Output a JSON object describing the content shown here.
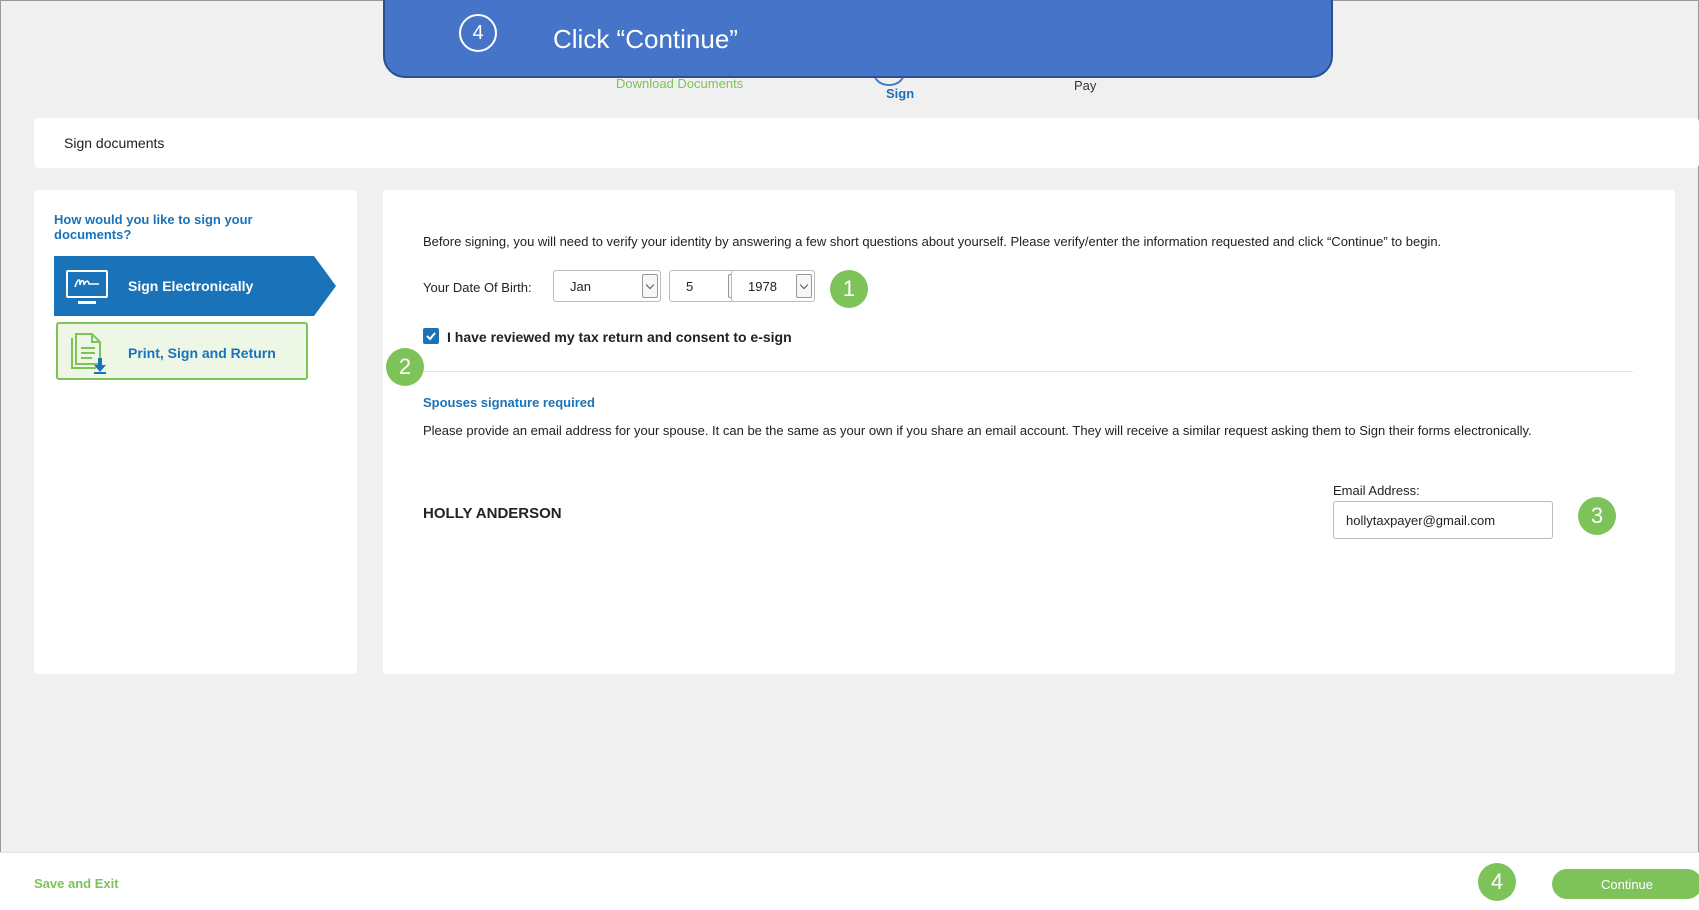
{
  "steps": {
    "download": "Download Documents",
    "sign": "Sign",
    "pay": "Pay"
  },
  "callout": {
    "number": "4",
    "text": "Click “Continue”"
  },
  "page_title": "Sign documents",
  "sidebar": {
    "heading": "How would you like to sign your documents?",
    "options": [
      {
        "label": "Sign Electronically",
        "icon": "signature-monitor-icon",
        "selected": true
      },
      {
        "label": "Print, Sign and Return",
        "icon": "download-document-icon",
        "selected": false
      }
    ]
  },
  "main": {
    "intro": "Before signing, you will need to verify your identity by answering a few short questions about yourself. Please verify/enter the information requested and click “Continue” to begin.",
    "dob_label": "Your Date Of Birth:",
    "dob": {
      "month": "Jan",
      "day": "5",
      "year": "1978"
    },
    "consent_label": "I have reviewed my tax return and consent to e-sign",
    "consent_checked": true,
    "spouse_heading": "Spouses signature required",
    "spouse_text": "Please provide an email address for your spouse. It can be the same as your own if you share an email account. They will receive a similar request asking them to Sign their forms electronically.",
    "spouse_name": "HOLLY ANDERSON",
    "email_label": "Email Address:",
    "email_value": "hollytaxpayer@gmail.com"
  },
  "markers": [
    "1",
    "2",
    "3",
    "4"
  ],
  "footer": {
    "save_exit": "Save and Exit",
    "continue": "Continue"
  },
  "colors": {
    "primary_blue": "#1a73b8",
    "accent_green": "#7ec35a",
    "callout_blue": "#4674c9",
    "background": "#f0f0f0"
  }
}
